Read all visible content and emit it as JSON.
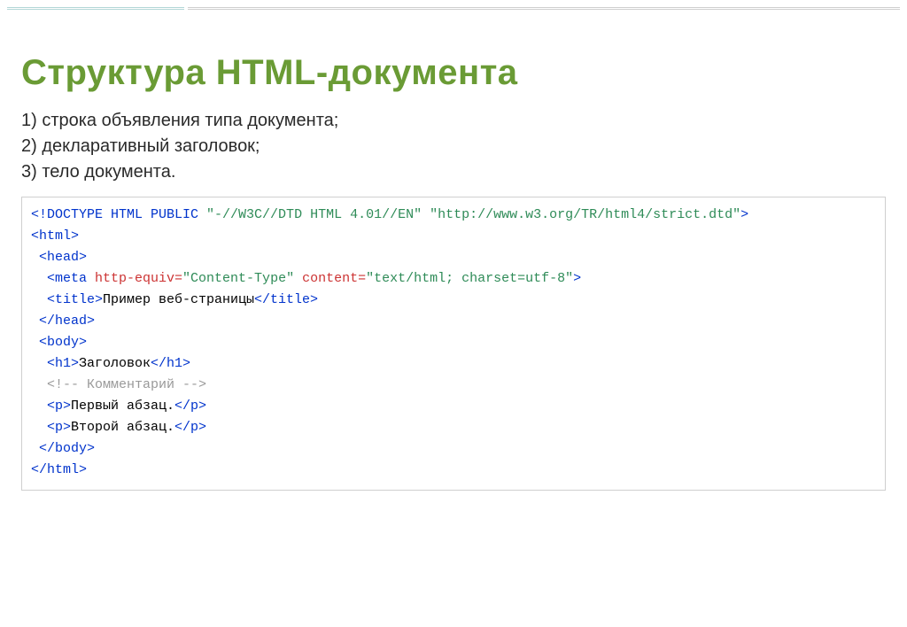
{
  "slide": {
    "title": "Структура HTML-документа",
    "points": {
      "p1": "1) строка объявления типа документа;",
      "p2": "2) декларативный заголовок;",
      "p3": "3) тело документа."
    },
    "code": {
      "doctype_open": "<!DOCTYPE HTML PUBLIC ",
      "doctype_str1": "\"-//W3C//DTD HTML 4.01//EN\"",
      "doctype_mid": " ",
      "doctype_str2": "\"http://www.w3.org/TR/html4/strict.dtd\"",
      "doctype_close": ">",
      "html_open": "<html>",
      "head_open": " <head>",
      "meta_open": "  <meta ",
      "meta_attr1": "http-equiv=",
      "meta_val1": "\"Content-Type\"",
      "meta_sp1": " ",
      "meta_attr2": "content=",
      "meta_val2": "\"text/html; charset=utf-8\"",
      "meta_close": ">",
      "title_open": "  <title>",
      "title_text": "Пример веб-страницы",
      "title_close": "</title>",
      "head_close": " </head>",
      "body_open": " <body>",
      "h1_open": "  <h1>",
      "h1_text": "Заголовок",
      "h1_close": "</h1>",
      "comment": "  <!-- Комментарий -->",
      "p1_open": "  <p>",
      "p1_text": "Первый абзац.",
      "p1_close": "</p>",
      "p2_open": "  <p>",
      "p2_text": "Второй абзац.",
      "p2_close": "</p>",
      "body_close": " </body>",
      "html_close": "</html>"
    }
  }
}
